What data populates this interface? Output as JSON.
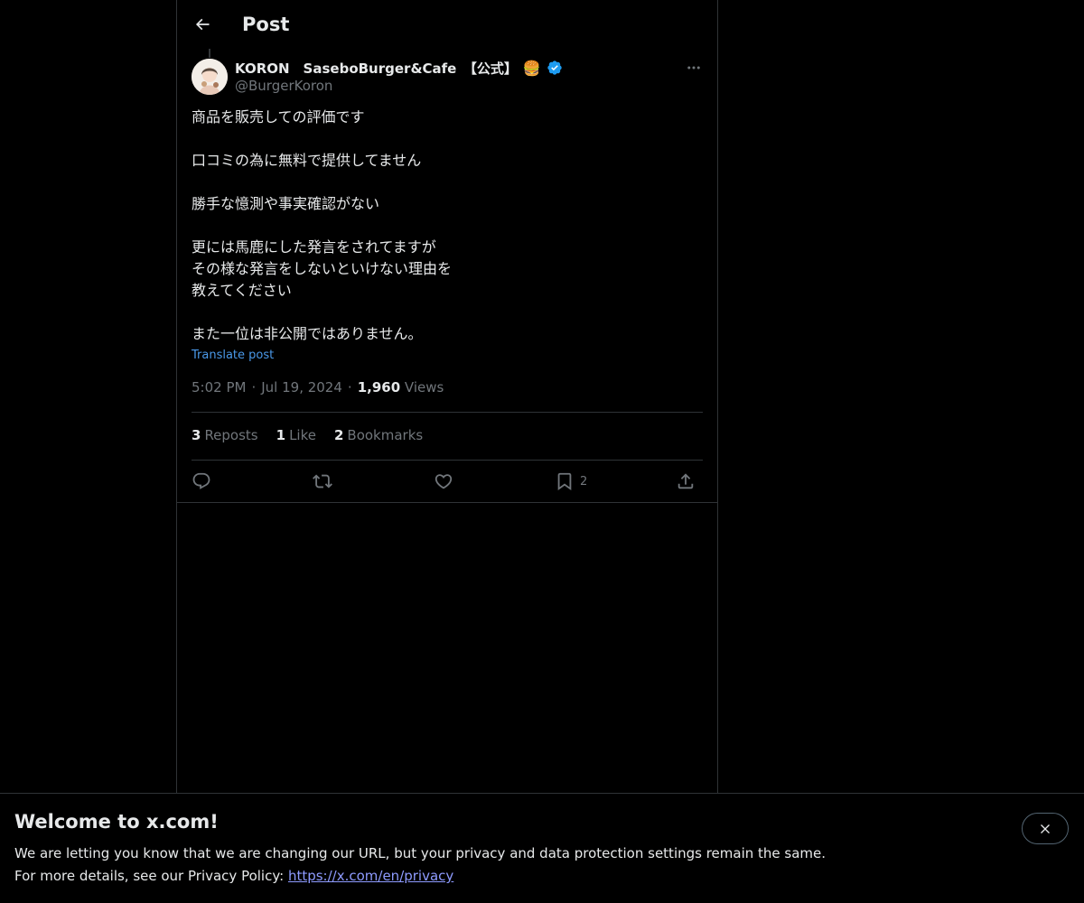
{
  "header": {
    "title": "Post"
  },
  "author": {
    "display_name": "KORON　SaseboBurger&Cafe　【公式】",
    "handle": "@BurgerKoron",
    "verified": true,
    "badge_emoji": "🍔"
  },
  "post": {
    "lines": [
      "商品を販売しての評価です",
      "",
      "口コミの為に無料で提供してません",
      "",
      "勝手な憶測や事実確認がない",
      "",
      "更には馬鹿にした発言をされてますが",
      "その様な発言をしないといけない理由を",
      "教えてください",
      "",
      "また一位は非公開ではありません。"
    ],
    "translate_label": "Translate post",
    "time": "5:02 PM",
    "date": "Jul 19, 2024",
    "separator": "·",
    "views_count": "1,960",
    "views_label": "Views"
  },
  "stats": {
    "reposts_count": "3",
    "reposts_label": "Reposts",
    "likes_count": "1",
    "likes_label": "Like",
    "bookmarks_count": "2",
    "bookmarks_label": "Bookmarks"
  },
  "actions": {
    "bookmark_count": "2"
  },
  "banner": {
    "title": "Welcome to x.com!",
    "line1": "We are letting you know that we are changing our URL, but your privacy and data protection settings remain the same.",
    "line2_prefix": "For more details, see our Privacy Policy: ",
    "link_text": "https://x.com/en/privacy"
  },
  "colors": {
    "accent": "#1d9bf0",
    "link": "#4a99e9",
    "muted": "#71767b",
    "text": "#e7e9ea",
    "border": "#2f3336"
  }
}
